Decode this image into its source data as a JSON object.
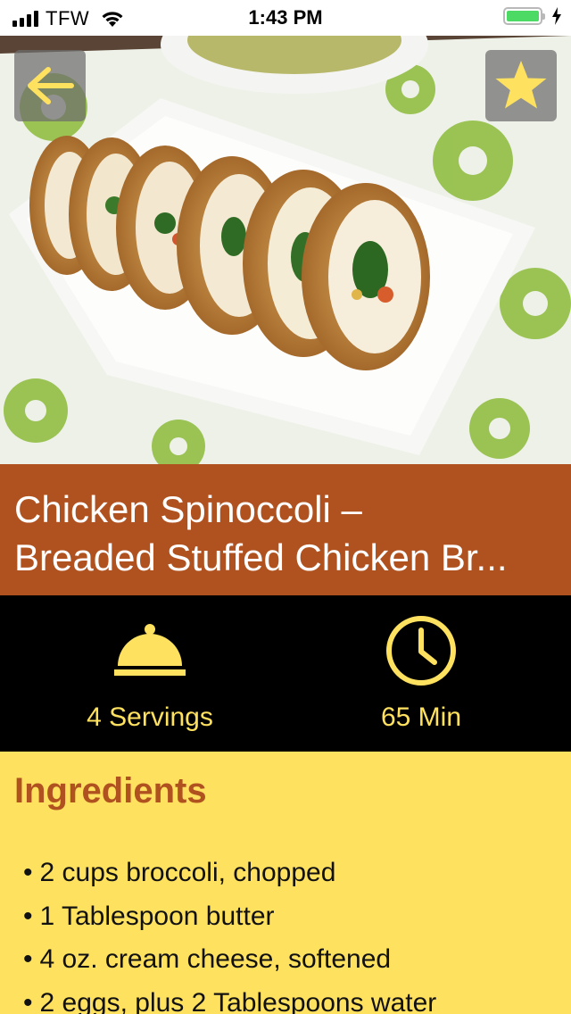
{
  "status_bar": {
    "carrier": "TFW",
    "time": "1:43 PM",
    "battery_color": "#4cd964"
  },
  "hero": {
    "back_icon": "arrow-left-icon",
    "favorite_icon": "star-icon"
  },
  "recipe": {
    "title_line1": "Chicken Spinoccoli –",
    "title_line2": "Breaded Stuffed Chicken Br...",
    "servings": "4 Servings",
    "time": "65 Min"
  },
  "ingredients": {
    "heading": "Ingredients",
    "items": [
      "2 cups broccoli, chopped",
      "1 Tablespoon butter",
      "4 oz. cream cheese, softened",
      "2 eggs, plus 2 Tablespoons water"
    ]
  },
  "colors": {
    "accent_yellow": "#ffe160",
    "title_band": "#b05220",
    "ingredients_bg": "#ffe160",
    "heading_text": "#b05220"
  }
}
